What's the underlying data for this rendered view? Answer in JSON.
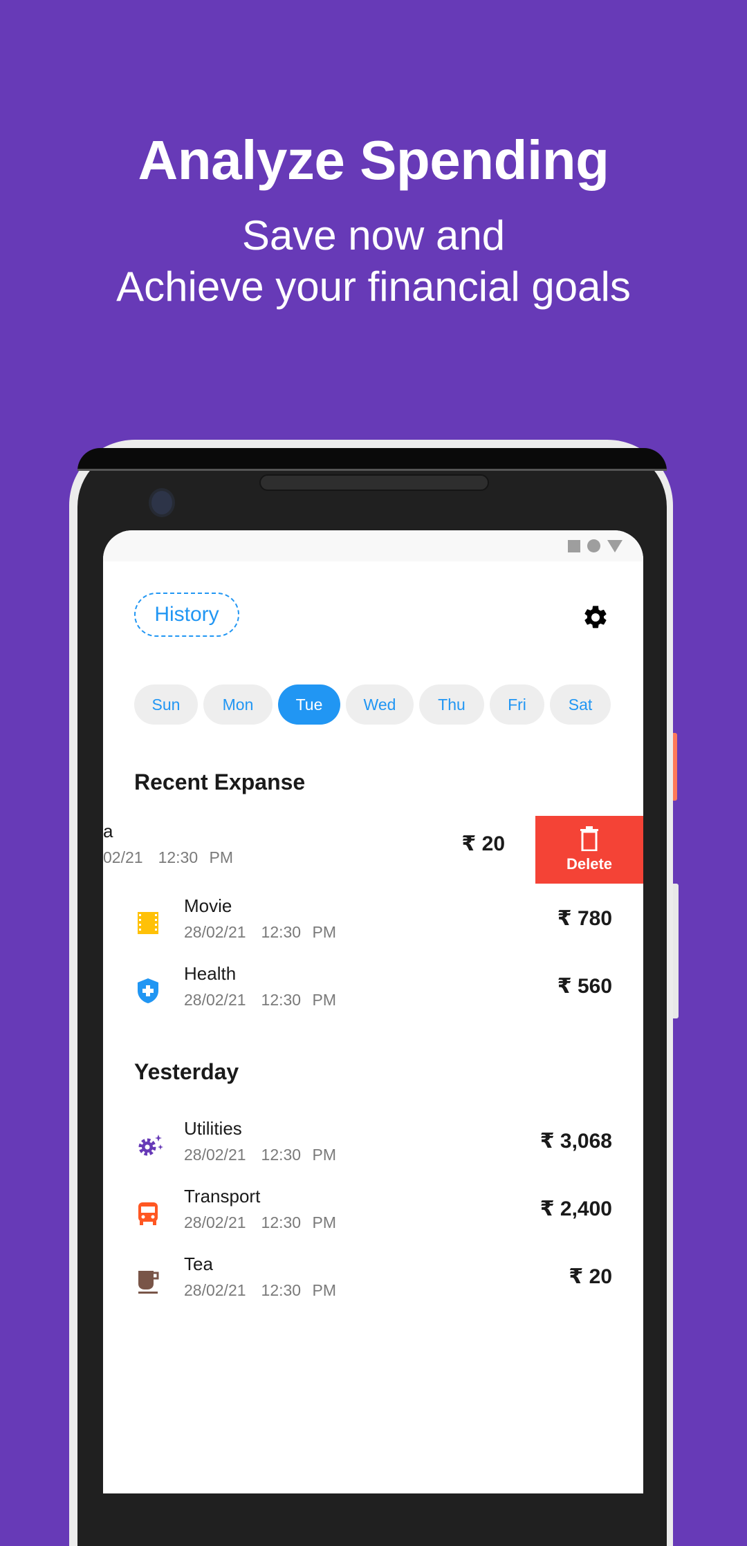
{
  "promo": {
    "title": "Analyze Spending",
    "subtitle_line1": "Save now and",
    "subtitle_line2": "Achieve your financial goals",
    "background_color": "#673ab7"
  },
  "status_bar": {
    "icons": [
      "square-icon",
      "circle-icon",
      "triangle-icon"
    ]
  },
  "header": {
    "history_label": "History",
    "settings_icon": "gear-icon"
  },
  "days": [
    {
      "label": "Sun",
      "active": false
    },
    {
      "label": "Mon",
      "active": false
    },
    {
      "label": "Tue",
      "active": true
    },
    {
      "label": "Wed",
      "active": false
    },
    {
      "label": "Thu",
      "active": false
    },
    {
      "label": "Fri",
      "active": false
    },
    {
      "label": "Sat",
      "active": false
    }
  ],
  "recent": {
    "title": "Recent Expanse",
    "swiped_item": {
      "name_fragment": "a",
      "date_fragment": "02/21",
      "time": "12:30 PM",
      "amount": "₹ 20",
      "delete_label": "Delete"
    },
    "items": [
      {
        "name": "Movie",
        "date": "28/02/21",
        "time": "12:30 PM",
        "amount": "₹ 780",
        "icon": "film-icon",
        "color": "#ffc107"
      },
      {
        "name": "Health",
        "date": "28/02/21",
        "time": "12:30 PM",
        "amount": "₹ 560",
        "icon": "shield-plus-icon",
        "color": "#2196f3"
      }
    ]
  },
  "yesterday": {
    "title": "Yesterday",
    "items": [
      {
        "name": "Utilities",
        "date": "28/02/21",
        "time": "12:30 PM",
        "amount": "₹ 3,068",
        "icon": "gear-sparkle-icon",
        "color": "#673ab7"
      },
      {
        "name": "Transport",
        "date": "28/02/21",
        "time": "12:30 PM",
        "amount": "₹ 2,400",
        "icon": "bus-icon",
        "color": "#ff5722"
      },
      {
        "name": "Tea",
        "date": "28/02/21",
        "time": "12:30 PM",
        "amount": "₹ 20",
        "icon": "cup-icon",
        "color": "#795548"
      }
    ]
  },
  "colors": {
    "accent": "#2196f3",
    "delete": "#f44336"
  }
}
